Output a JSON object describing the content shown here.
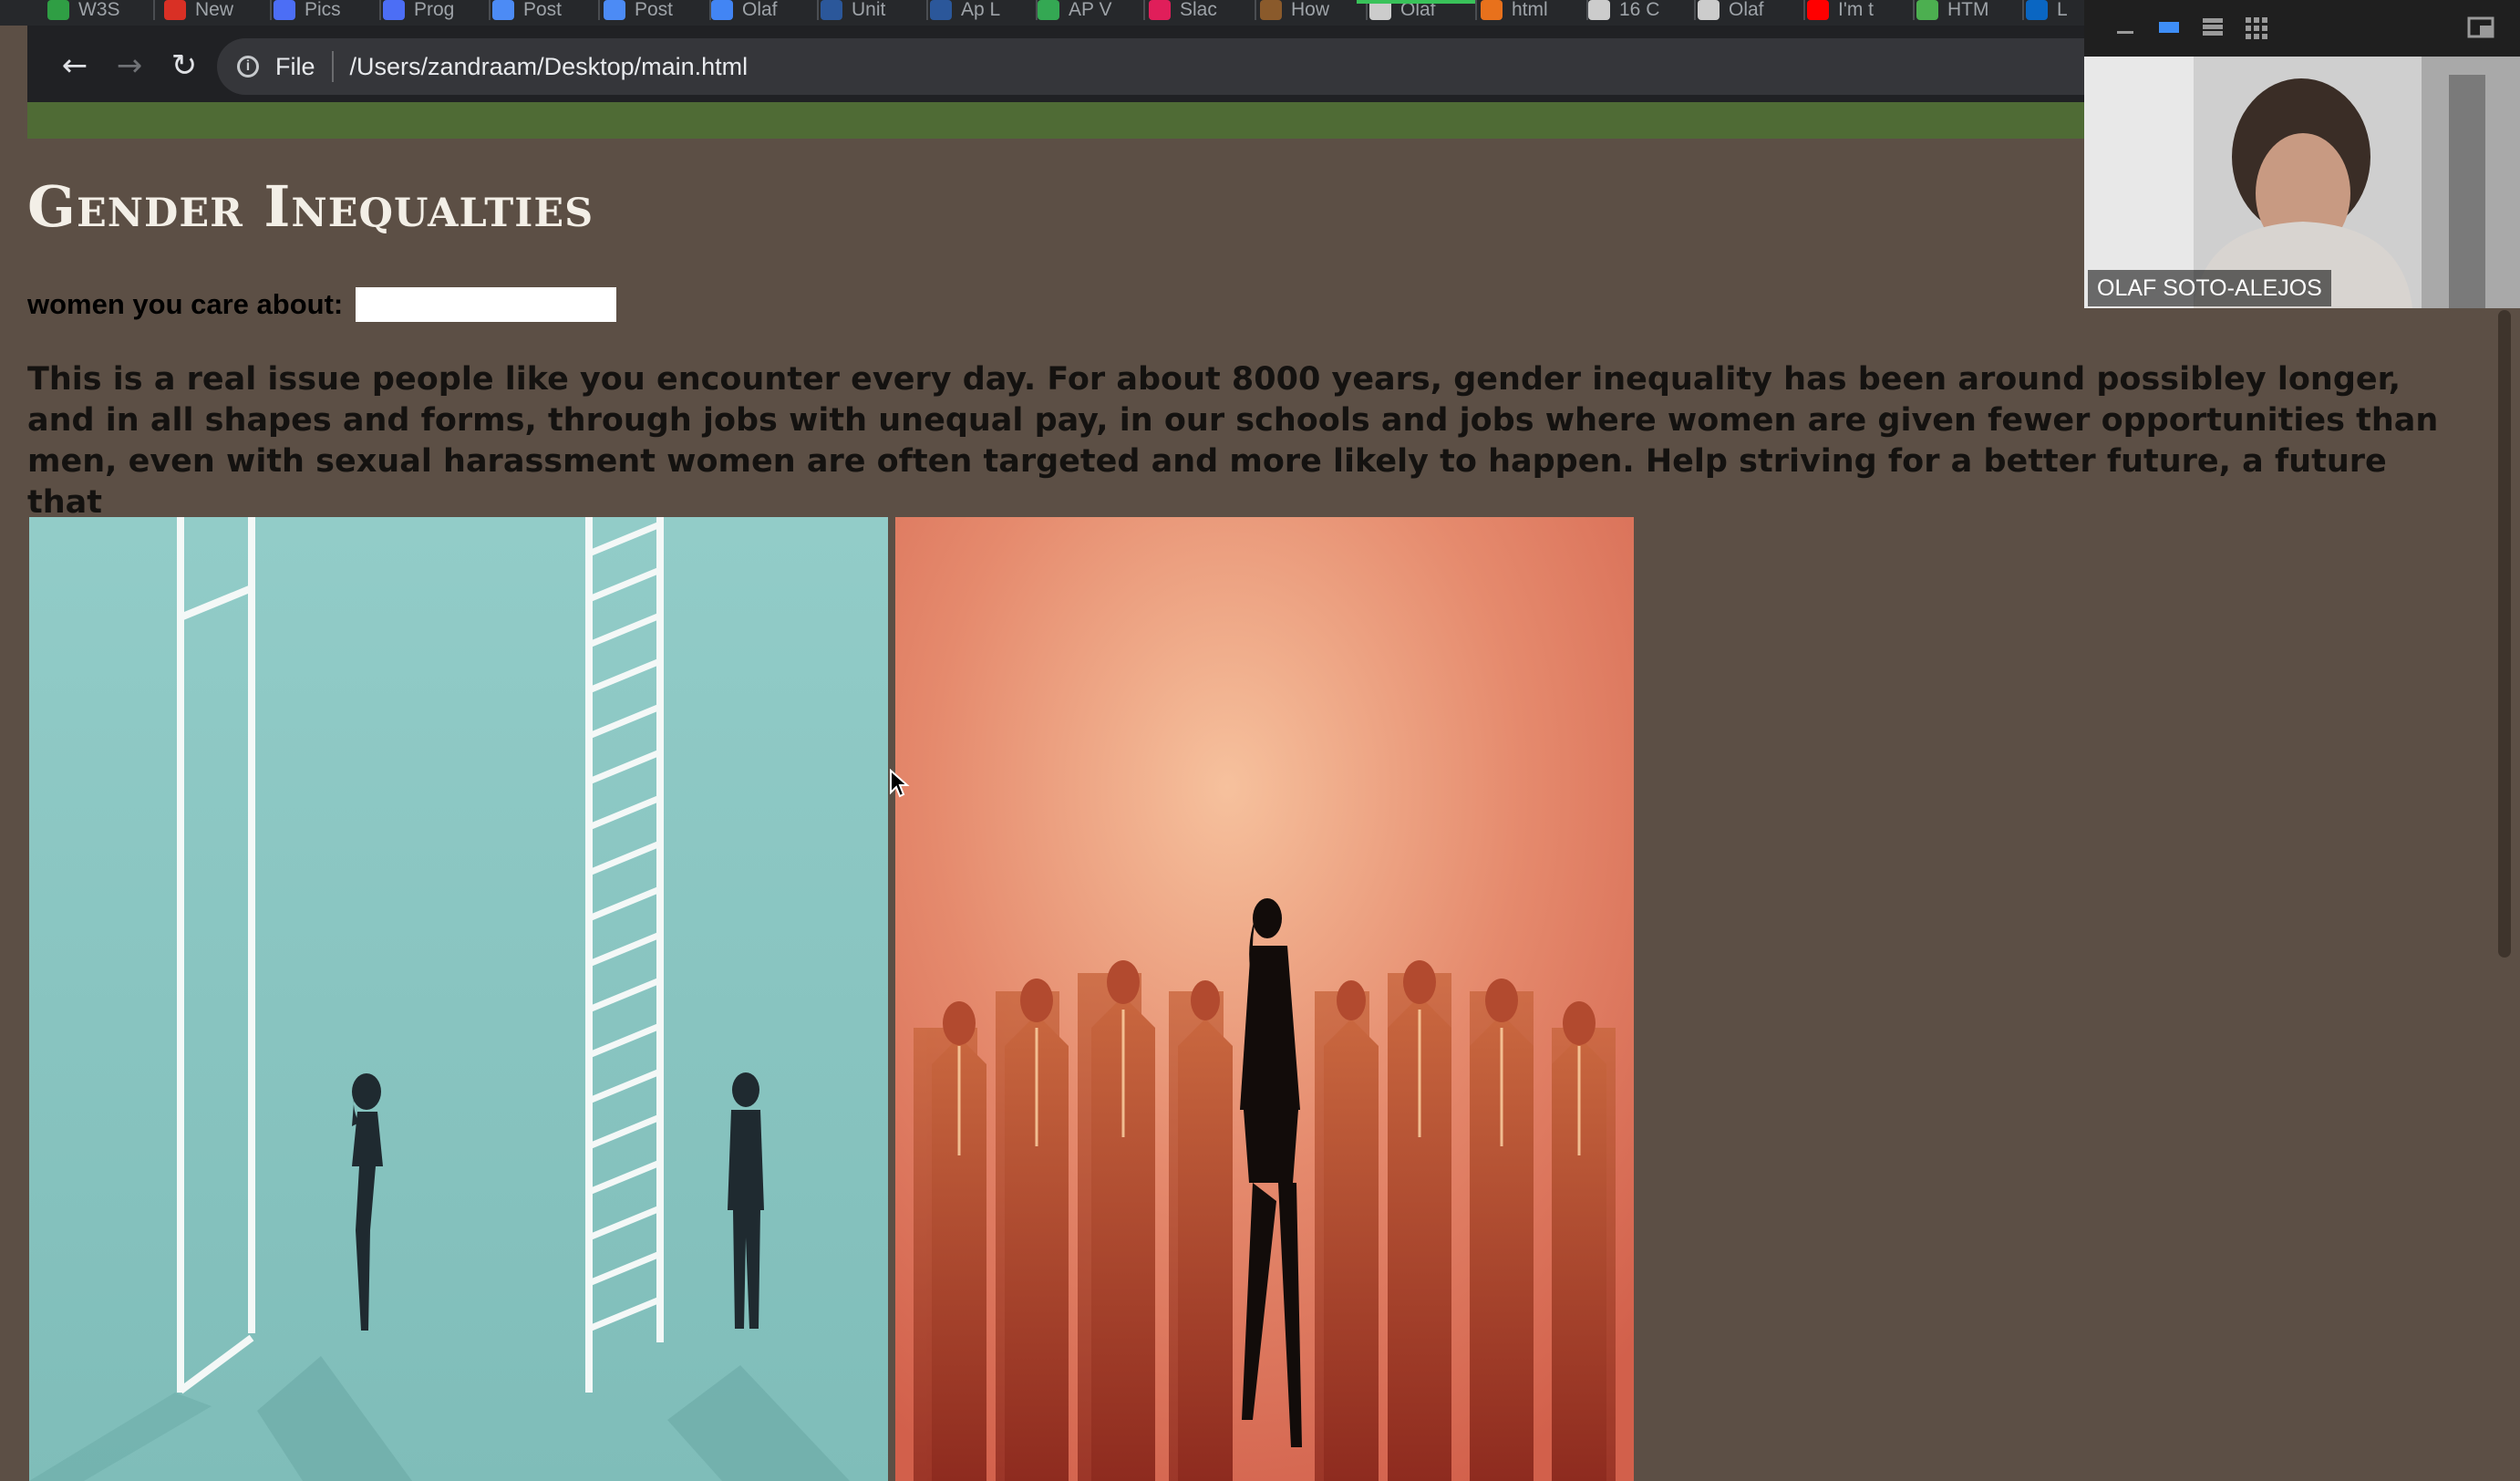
{
  "browser": {
    "tabs": [
      {
        "label": "W3S",
        "color": "#2f9e44"
      },
      {
        "label": "New",
        "color": "#d93025"
      },
      {
        "label": "Pics",
        "color": "#4c6ef5"
      },
      {
        "label": "Prog",
        "color": "#4c6ef5"
      },
      {
        "label": "Post",
        "color": "#4c8bf5"
      },
      {
        "label": "Post",
        "color": "#4c8bf5"
      },
      {
        "label": "Olaf",
        "color": "#4285f4"
      },
      {
        "label": "Unit",
        "color": "#2b579a"
      },
      {
        "label": "Ap L",
        "color": "#2b579a"
      },
      {
        "label": "AP V",
        "color": "#34a853"
      },
      {
        "label": "Slac",
        "color": "#e01e5a"
      },
      {
        "label": "How",
        "color": "#8a5a2b"
      },
      {
        "label": "Olaf",
        "color": "#cccccc"
      },
      {
        "label": "html",
        "color": "#e8711c"
      },
      {
        "label": "16 C",
        "color": "#cccccc"
      },
      {
        "label": "Olaf",
        "color": "#cccccc"
      },
      {
        "label": "I'm t",
        "color": "#ff0000"
      },
      {
        "label": "HTM",
        "color": "#4caf50"
      },
      {
        "label": "L",
        "color": "#0a66c2"
      }
    ],
    "scheme_label": "File",
    "url": "/Users/zandraam/Desktop/main.html"
  },
  "page": {
    "heading": "Gender Inequalties",
    "input_label": "women you care about:",
    "input_value": "",
    "paragraph": "This is a real issue people like you encounter every day. For about 8000 years, gender inequality has been around possibley longer, and in all shapes and forms, through jobs with unequal pay, in our schools and jobs where women are given fewer opportunities than men, even with sexual harassment women are often targeted and more likely to happen. Help striving for a better future, a future that",
    "images": [
      {
        "icon": "ladders-illustration",
        "background": "#88c5c1"
      },
      {
        "icon": "woman-among-men-illustration",
        "background": "#e07a63"
      }
    ]
  },
  "video_call": {
    "participant_name": "OLAF SOTO-ALEJOS"
  }
}
